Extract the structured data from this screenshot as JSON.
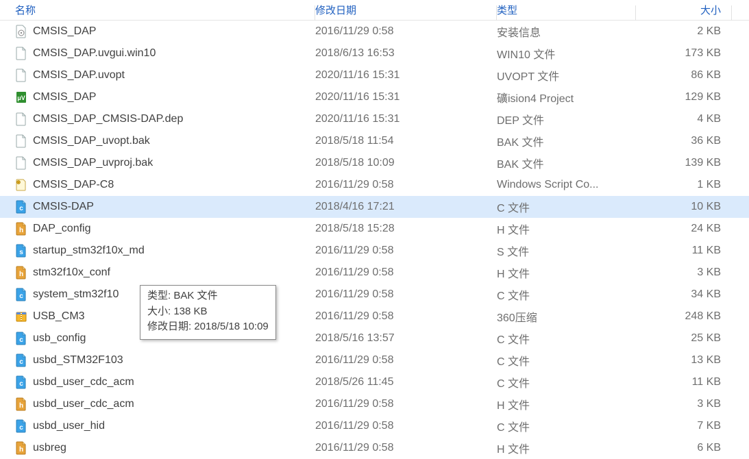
{
  "columns": {
    "name": "名称",
    "date": "修改日期",
    "type": "类型",
    "size": "大小"
  },
  "tooltip": {
    "line1": "类型: BAK 文件",
    "line2": "大小: 138 KB",
    "line3": "修改日期: 2018/5/18 10:09"
  },
  "files": [
    {
      "icon": "inf",
      "name": "CMSIS_DAP",
      "date": "2016/11/29 0:58",
      "type": "安装信息",
      "size": "2 KB",
      "selected": false
    },
    {
      "icon": "blank",
      "name": "CMSIS_DAP.uvgui.win10",
      "date": "2018/6/13 16:53",
      "type": "WIN10 文件",
      "size": "173 KB",
      "selected": false
    },
    {
      "icon": "blank",
      "name": "CMSIS_DAP.uvopt",
      "date": "2020/11/16 15:31",
      "type": "UVOPT 文件",
      "size": "86 KB",
      "selected": false
    },
    {
      "icon": "uvproj",
      "name": "CMSIS_DAP",
      "date": "2020/11/16 15:31",
      "type": "礦ision4 Project",
      "size": "129 KB",
      "selected": false
    },
    {
      "icon": "blank",
      "name": "CMSIS_DAP_CMSIS-DAP.dep",
      "date": "2020/11/16 15:31",
      "type": "DEP 文件",
      "size": "4 KB",
      "selected": false
    },
    {
      "icon": "blank",
      "name": "CMSIS_DAP_uvopt.bak",
      "date": "2018/5/18 11:54",
      "type": "BAK 文件",
      "size": "36 KB",
      "selected": false
    },
    {
      "icon": "blank",
      "name": "CMSIS_DAP_uvproj.bak",
      "date": "2018/5/18 10:09",
      "type": "BAK 文件",
      "size": "139 KB",
      "selected": false
    },
    {
      "icon": "script",
      "name": "CMSIS_DAP-C8",
      "date": "2016/11/29 0:58",
      "type": "Windows Script Co...",
      "size": "1 KB",
      "selected": false
    },
    {
      "icon": "c",
      "name": "CMSIS-DAP",
      "date": "2018/4/16 17:21",
      "type": "C 文件",
      "size": "10 KB",
      "selected": true
    },
    {
      "icon": "h",
      "name": "DAP_config",
      "date": "2018/5/18 15:28",
      "type": "H 文件",
      "size": "24 KB",
      "selected": false
    },
    {
      "icon": "s",
      "name": "startup_stm32f10x_md",
      "date": "2016/11/29 0:58",
      "type": "S 文件",
      "size": "11 KB",
      "selected": false
    },
    {
      "icon": "h",
      "name": "stm32f10x_conf",
      "date": "2016/11/29 0:58",
      "type": "H 文件",
      "size": "3 KB",
      "selected": false
    },
    {
      "icon": "c",
      "name": "system_stm32f10",
      "date": "2016/11/29 0:58",
      "type": "C 文件",
      "size": "34 KB",
      "selected": false
    },
    {
      "icon": "zip",
      "name": "USB_CM3",
      "date": "2016/11/29 0:58",
      "type": "360压缩",
      "size": "248 KB",
      "selected": false
    },
    {
      "icon": "c",
      "name": "usb_config",
      "date": "2018/5/16 13:57",
      "type": "C 文件",
      "size": "25 KB",
      "selected": false
    },
    {
      "icon": "c",
      "name": "usbd_STM32F103",
      "date": "2016/11/29 0:58",
      "type": "C 文件",
      "size": "13 KB",
      "selected": false
    },
    {
      "icon": "c",
      "name": "usbd_user_cdc_acm",
      "date": "2018/5/26 11:45",
      "type": "C 文件",
      "size": "11 KB",
      "selected": false
    },
    {
      "icon": "h",
      "name": "usbd_user_cdc_acm",
      "date": "2016/11/29 0:58",
      "type": "H 文件",
      "size": "3 KB",
      "selected": false
    },
    {
      "icon": "c",
      "name": "usbd_user_hid",
      "date": "2016/11/29 0:58",
      "type": "C 文件",
      "size": "7 KB",
      "selected": false
    },
    {
      "icon": "h",
      "name": "usbreg",
      "date": "2016/11/29 0:58",
      "type": "H 文件",
      "size": "6 KB",
      "selected": false
    }
  ]
}
